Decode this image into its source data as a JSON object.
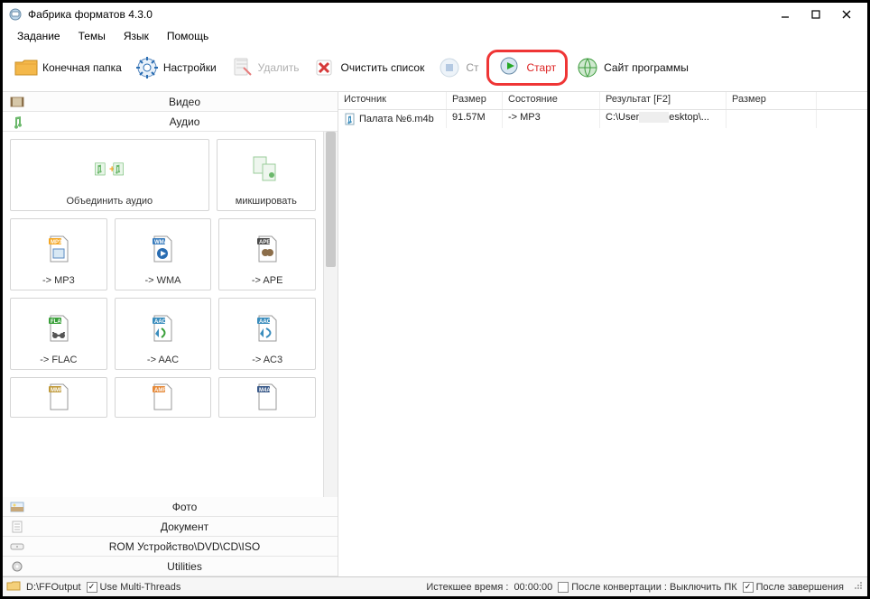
{
  "titlebar": {
    "title": "Фабрика форматов 4.3.0"
  },
  "menu": {
    "task": "Задание",
    "themes": "Темы",
    "language": "Язык",
    "help": "Помощь"
  },
  "toolbar": {
    "output_folder": "Конечная папка",
    "settings": "Настройки",
    "delete": "Удалить",
    "clear_list": "Очистить список",
    "stop_short": "Ст",
    "start": "Старт",
    "site": "Сайт программы"
  },
  "categories": {
    "video": "Видео",
    "audio": "Аудио",
    "photo": "Фото",
    "document": "Документ",
    "rom": "ROM Устройство\\DVD\\CD\\ISO",
    "utilities": "Utilities"
  },
  "formats": {
    "join_audio": "Объединить аудио",
    "mix": "микшировать",
    "mp3": "-> MP3",
    "wma": "-> WMA",
    "ape": "-> APE",
    "flac": "-> FLAC",
    "aac": "-> AAC",
    "ac3": "-> AC3"
  },
  "tags": {
    "mp3": "MP3",
    "wma": "WMA",
    "ape": "APE",
    "fla": "FLA",
    "aac": "AAC",
    "aac2": "AAC",
    "mmf": "MMF",
    "amr": "AMR",
    "m4a": "M4A"
  },
  "list": {
    "headers": {
      "source": "Источник",
      "size": "Размер",
      "state": "Состояние",
      "result": "Результат [F2]",
      "size2": "Размер"
    },
    "rows": [
      {
        "source": "Палата №6.m4b",
        "size": "91.57M",
        "state": "-> MP3",
        "result_prefix": "C:\\User",
        "result_suffix": "esktop\\...",
        "size2": ""
      }
    ]
  },
  "status": {
    "output_path": "D:\\FFOutput",
    "multi_threads": "Use Multi-Threads",
    "elapsed_label": "Истекшее время :",
    "elapsed_time": "00:00:00",
    "after_conv": "После конвертации : Выключить ПК",
    "after_done": "После завершения"
  }
}
